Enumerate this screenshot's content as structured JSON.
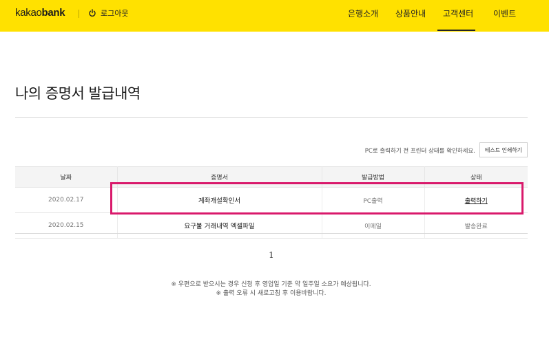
{
  "header": {
    "logo_left": "kakao",
    "logo_right": "bank",
    "logout_label": "로그아웃",
    "nav": [
      {
        "label": "은행소개"
      },
      {
        "label": "상품안내"
      },
      {
        "label": "고객센터",
        "active": true
      },
      {
        "label": "이벤트"
      }
    ],
    "background_color": "#ffe100"
  },
  "main": {
    "title": "나의 증명서 발급내역",
    "print_notice": "PC로 출력하기 전 프린터 상태를 확인하세요.",
    "test_print_label": "테스트 인쇄하기",
    "table": {
      "headers": [
        "날짜",
        "증명서",
        "발급방법",
        "상태"
      ],
      "rows": [
        {
          "date": "2020.02.17",
          "document": "계좌개설확인서",
          "method": "PC출력",
          "status": "출력하기",
          "status_link": true
        },
        {
          "date": "2020.02.15",
          "document": "요구불 거래내역 엑셀파일",
          "method": "이메일",
          "status": "발송완료",
          "status_link": false
        }
      ]
    },
    "pagination": {
      "current": "1"
    },
    "notes": [
      "※ 우편으로 받으시는 경우 신청 후 영업일 기준 약 일주일 소요가 예상됩니다.",
      "※ 출력 오류 시 새로고침 후 이용바랍니다."
    ],
    "highlight_color": "#d9196b"
  }
}
